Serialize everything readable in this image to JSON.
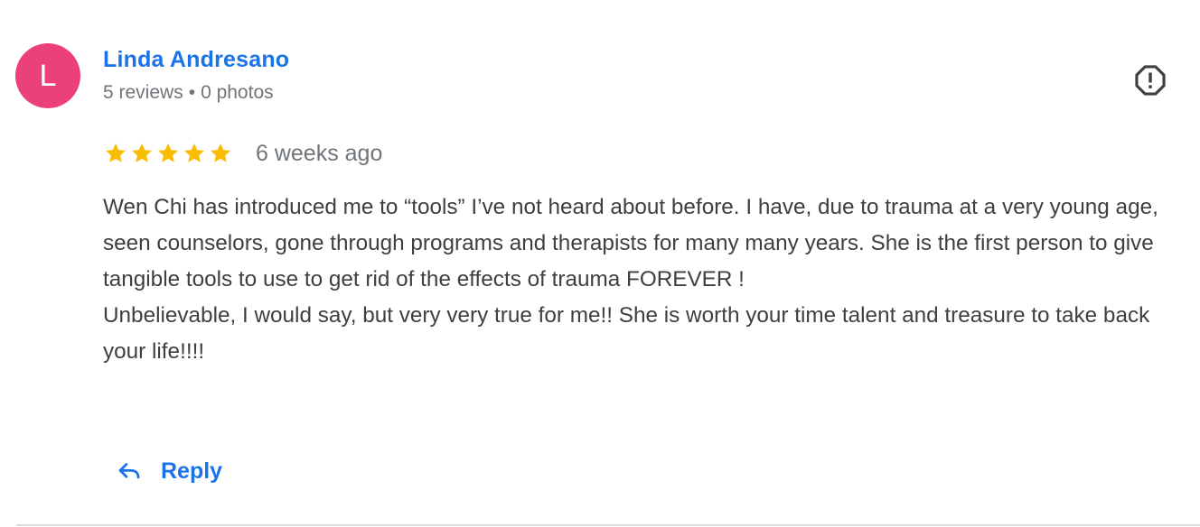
{
  "review": {
    "avatar_initial": "L",
    "avatar_color": "#ec407a",
    "author_name": "Linda Andresano",
    "reviews_count": "5 reviews",
    "meta_separator": "•",
    "photos_count": "0 photos",
    "rating": 5,
    "rating_max": 5,
    "star_color": "#fbbc04",
    "date": "6 weeks ago",
    "paragraphs": [
      "Wen Chi has introduced me to “tools” I’ve not heard about before. I have, due to trauma at a very young age, seen counselors, gone through programs and therapists for many many years. She is the first person to give tangible tools to use to get rid of the effects of trauma FOREVER !",
      "Unbelievable, I would say, but very very true for me!! She is worth your time talent and treasure to take back your life!!!!"
    ],
    "flag_icon": "report-flag-icon",
    "reply_icon": "reply-arrow-icon",
    "reply_label": "Reply",
    "accent_color": "#1a73e8"
  }
}
